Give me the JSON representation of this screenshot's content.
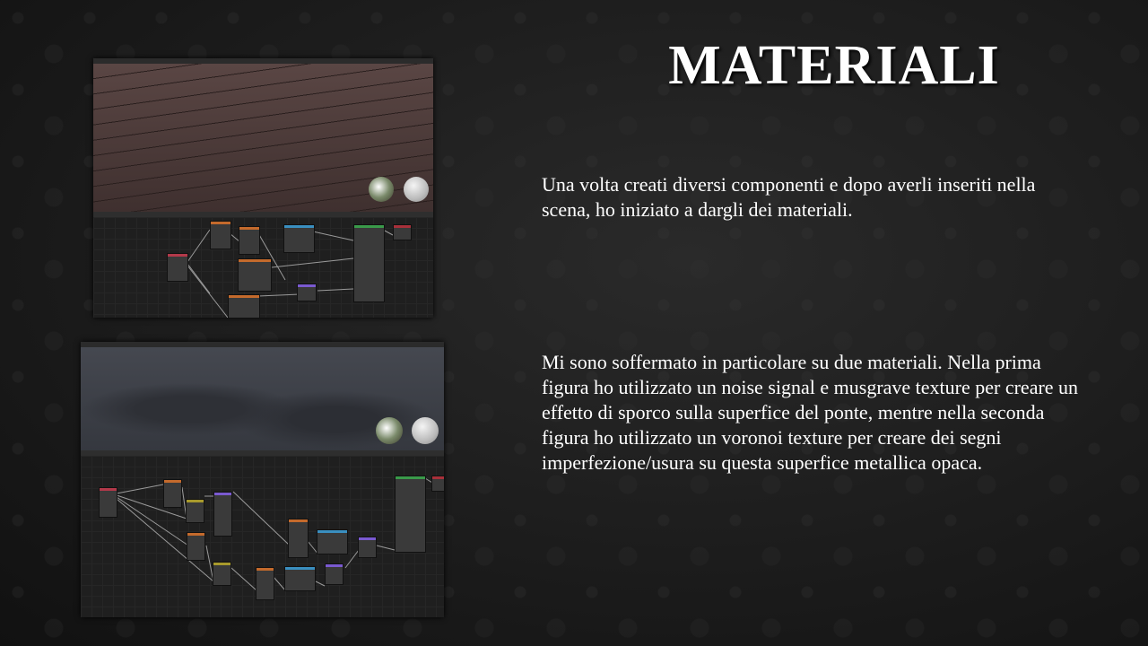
{
  "slide": {
    "title": "MATERIALI",
    "paragraph_1": "Una volta creati diversi componenti e dopo averli inseriti nella scena, ho iniziato a dargli dei materiali.",
    "paragraph_2": "Mi sono soffermato in particolare su due materiali. Nella prima figura ho utilizzato un noise signal e musgrave texture per creare un effetto di sporco sulla superfice del ponte, mentre nella seconda figura ho utilizzato un voronoi texture per creare dei segni imperfezione/usura su questa superfice metallica opaca."
  },
  "figures": [
    {
      "name": "wood-floor-material-screenshot",
      "viewport_color": "#4a3a38"
    },
    {
      "name": "metal-surface-material-screenshot",
      "viewport_color": "#3a3d44"
    }
  ],
  "node_colors": {
    "input": "#b3394a",
    "texture": "#c46a2c",
    "color": "#3a8fc0",
    "vector": "#7a5ad0",
    "shader": "#3a9a4a",
    "output": "#a8303a",
    "converter": "#a89a2c"
  }
}
